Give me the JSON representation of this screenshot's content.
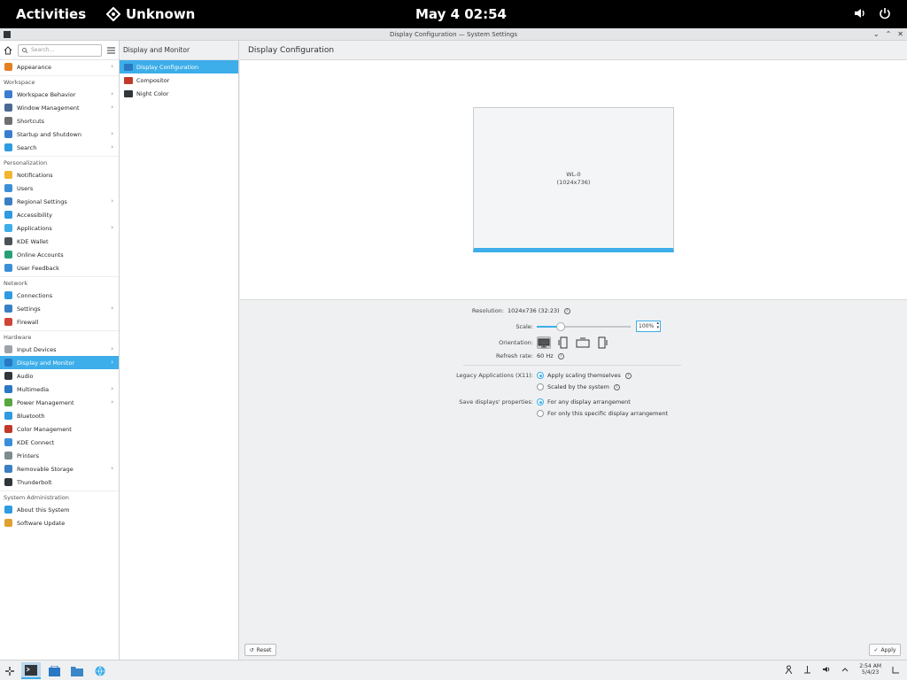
{
  "topbar": {
    "activities": "Activities",
    "app_name": "Unknown",
    "clock": "May 4  02:54"
  },
  "window": {
    "title": "Display Configuration — System Settings"
  },
  "sidebar": {
    "search_placeholder": "Search...",
    "groups": [
      {
        "items": [
          {
            "label": "Appearance",
            "icon": "appearance-icon",
            "color": "#e67e22",
            "chevron": true
          }
        ]
      },
      {
        "category": "Workspace",
        "items": [
          {
            "label": "Workspace Behavior",
            "icon": "workspace-icon",
            "color": "#3b7ecf",
            "chevron": true
          },
          {
            "label": "Window Management",
            "icon": "window-icon",
            "color": "#4c6a91",
            "chevron": true
          },
          {
            "label": "Shortcuts",
            "icon": "keyboard-icon",
            "color": "#6d6f73",
            "chevron": false
          },
          {
            "label": "Startup and Shutdown",
            "icon": "startup-icon",
            "color": "#3b7ecf",
            "chevron": true
          },
          {
            "label": "Search",
            "icon": "search-icon",
            "color": "#2f9be0",
            "chevron": true
          }
        ]
      },
      {
        "category": "Personalization",
        "items": [
          {
            "label": "Notifications",
            "icon": "bell-icon",
            "color": "#f1b530",
            "chevron": false
          },
          {
            "label": "Users",
            "icon": "users-icon",
            "color": "#3b8fd8",
            "chevron": false
          },
          {
            "label": "Regional Settings",
            "icon": "regional-icon",
            "color": "#3a7fc4",
            "chevron": true
          },
          {
            "label": "Accessibility",
            "icon": "accessibility-icon",
            "color": "#2f9be0",
            "chevron": false
          },
          {
            "label": "Applications",
            "icon": "applications-icon",
            "color": "#3daee9",
            "chevron": true
          },
          {
            "label": "KDE Wallet",
            "icon": "wallet-icon",
            "color": "#4b5359",
            "chevron": false
          },
          {
            "label": "Online Accounts",
            "icon": "online-accounts-icon",
            "color": "#27a07a",
            "chevron": false
          },
          {
            "label": "User Feedback",
            "icon": "feedback-icon",
            "color": "#3b8fd8",
            "chevron": false
          }
        ]
      },
      {
        "category": "Network",
        "items": [
          {
            "label": "Connections",
            "icon": "network-icon",
            "color": "#2f9be0",
            "chevron": false
          },
          {
            "label": "Settings",
            "icon": "network-settings-icon",
            "color": "#3a7fc4",
            "chevron": true
          },
          {
            "label": "Firewall",
            "icon": "firewall-icon",
            "color": "#d0453a",
            "chevron": false
          }
        ]
      },
      {
        "category": "Hardware",
        "items": [
          {
            "label": "Input Devices",
            "icon": "mouse-icon",
            "color": "#9da3a8",
            "chevron": true
          },
          {
            "label": "Display and Monitor",
            "icon": "monitor-icon",
            "color": "#2a78c4",
            "chevron": true,
            "selected": true
          },
          {
            "label": "Audio",
            "icon": "audio-icon",
            "color": "#31363b",
            "chevron": false
          },
          {
            "label": "Multimedia",
            "icon": "multimedia-icon",
            "color": "#2a78c4",
            "chevron": true
          },
          {
            "label": "Power Management",
            "icon": "power-icon",
            "color": "#5aa640",
            "chevron": true
          },
          {
            "label": "Bluetooth",
            "icon": "bluetooth-icon",
            "color": "#2f9be0",
            "chevron": false
          },
          {
            "label": "Color Management",
            "icon": "color-management-icon",
            "color": "#c0392b",
            "chevron": false
          },
          {
            "label": "KDE Connect",
            "icon": "kde-connect-icon",
            "color": "#3b8fd8",
            "chevron": false
          },
          {
            "label": "Printers",
            "icon": "printer-icon",
            "color": "#7f8c8d",
            "chevron": false
          },
          {
            "label": "Removable Storage",
            "icon": "usb-icon",
            "color": "#3a7fc4",
            "chevron": true
          },
          {
            "label": "Thunderbolt",
            "icon": "thunderbolt-icon",
            "color": "#31363b",
            "chevron": false
          }
        ]
      },
      {
        "category": "System Administration",
        "items": [
          {
            "label": "About this System",
            "icon": "info-icon",
            "color": "#2f9be0",
            "chevron": false
          },
          {
            "label": "Software Update",
            "icon": "update-icon",
            "color": "#e0a030",
            "chevron": false
          }
        ]
      }
    ]
  },
  "subpanel": {
    "heading": "Display and Monitor",
    "items": [
      {
        "label": "Display Configuration",
        "icon": "display-config-icon",
        "color": "#2a78c4",
        "selected": true
      },
      {
        "label": "Compositor",
        "icon": "compositor-icon",
        "color": "#c0392b",
        "selected": false
      },
      {
        "label": "Night Color",
        "icon": "night-color-icon",
        "color": "#31363b",
        "selected": false
      }
    ]
  },
  "main": {
    "heading": "Display Configuration",
    "output": {
      "name": "WL-0",
      "resolution": "(1024x736)"
    },
    "resolution_label": "Resolution:",
    "resolution_value": "1024x736 (32:23)",
    "scale_label": "Scale:",
    "scale_value": "100%",
    "scale_fraction": 0.25,
    "orientation_label": "Orientation:",
    "refresh_label": "Refresh rate:",
    "refresh_value": "60 Hz",
    "legacy_label": "Legacy Applications (X11):",
    "legacy_options": [
      "Apply scaling themselves",
      "Scaled by the system"
    ],
    "save_label": "Save displays' properties:",
    "save_options": [
      "For any display arrangement",
      "For only this specific display arrangement"
    ],
    "reset_button": "Reset",
    "apply_button": "Apply"
  },
  "taskbar": {
    "time": "2:54 AM",
    "date": "5/4/23"
  },
  "colors": {
    "accent": "#3daee9",
    "window_bg": "#eff0f1"
  }
}
